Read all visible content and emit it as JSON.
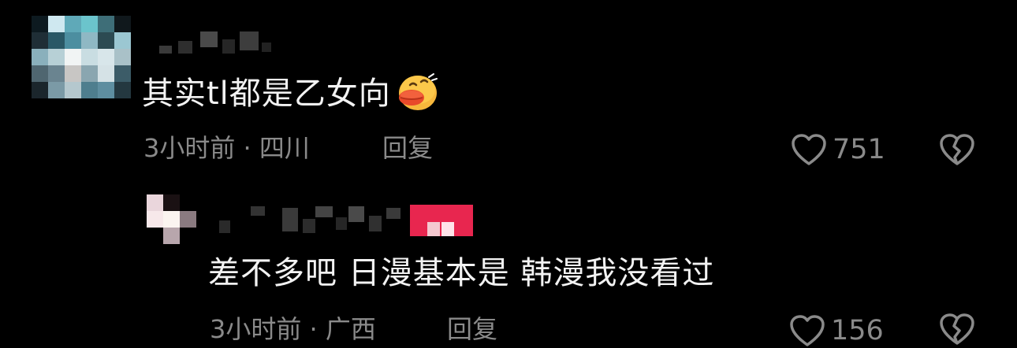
{
  "comments": [
    {
      "avatar_colors": [
        "#0d1a20",
        "#cfe8f0",
        "#5fa9b8",
        "#6bc4cc",
        "#3e6e78",
        "#10181c",
        "#1f2e36",
        "#2a5866",
        "#4c8ea0",
        "#8fb8c4",
        "#2c4a52",
        "#9bc7d2",
        "#8ab0bc",
        "#b7d0d6",
        "#f1f4f4",
        "#c9dde2",
        "#d8e6ea",
        "#a9c1c8",
        "#4f6670",
        "#6a8490",
        "#c8c6c4",
        "#8aa6b0",
        "#d5e2e6",
        "#3c5c68",
        "#1b262c",
        "#7b9aa6",
        "#b5c8ce",
        "#4e7e8e",
        "#5e8ea0",
        "#243840"
      ],
      "text": "其实tl都是乙女向",
      "emoji_icon": "duck-lips-emoji-icon",
      "time": "3小时前",
      "separator": "·",
      "location": "四川",
      "reply_label": "回复",
      "like_icon": "heart-outline-icon",
      "like_count": "751",
      "dislike_icon": "broken-heart-icon"
    },
    {
      "avatar_colors": [
        "#ead6dc",
        "#1a1113",
        "#000000",
        "#f7e8ea",
        "#fbf4f0",
        "#8a7a80",
        "#000000",
        "#b8a6ac",
        "#000000"
      ],
      "badge_color": "#e8264f",
      "text": "差不多吧 日漫基本是 韩漫我没看过",
      "time": "3小时前",
      "separator": "·",
      "location": "广西",
      "reply_label": "回复",
      "like_icon": "heart-outline-icon",
      "like_count": "156",
      "dislike_icon": "broken-heart-icon"
    }
  ]
}
